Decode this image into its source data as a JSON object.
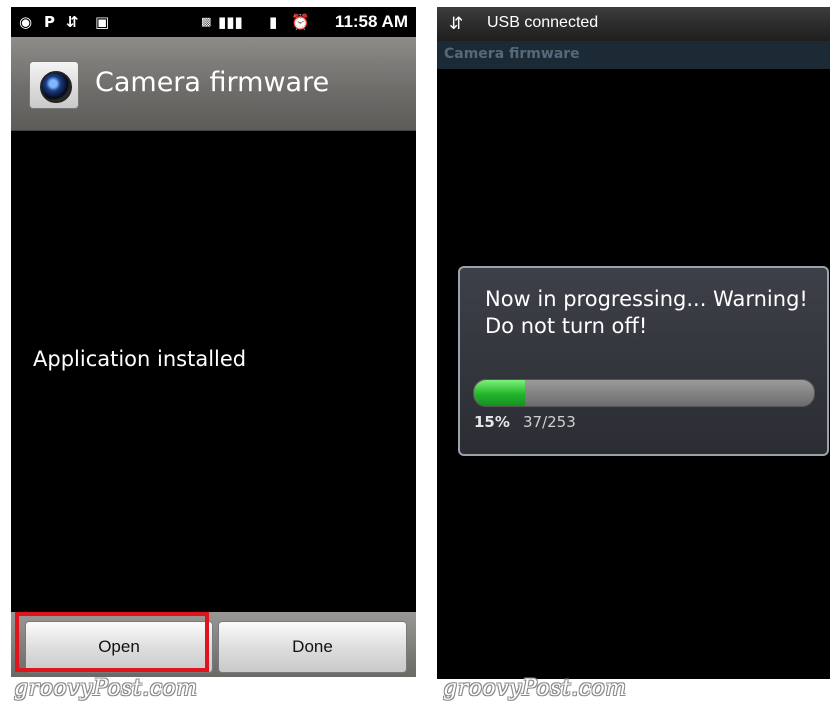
{
  "left_phone": {
    "status_bar": {
      "time": "11:58 AM",
      "icons": [
        "notification-icon",
        "p-icon",
        "usb-icon",
        "android-icon",
        "3g-icon",
        "signal-icon",
        "battery-icon",
        "alarm-icon"
      ]
    },
    "title_bar": {
      "icon": "camera-lens-icon",
      "title": "Camera firmware"
    },
    "body": {
      "message": "Application installed"
    },
    "buttons": {
      "open_label": "Open",
      "done_label": "Done"
    },
    "highlight_color": "#e0141c"
  },
  "right_phone": {
    "status_bar": {
      "icon": "usb-icon",
      "text": "USB connected"
    },
    "title_bar": {
      "title": "Camera firmware"
    },
    "dialog": {
      "message": "Now in progressing... Warning! Do not turn off!",
      "progress_percent": 15,
      "progress_label": "15%",
      "progress_count": "37/253",
      "progress_color": "#22b52b"
    }
  },
  "watermark": "groovyPost.com"
}
